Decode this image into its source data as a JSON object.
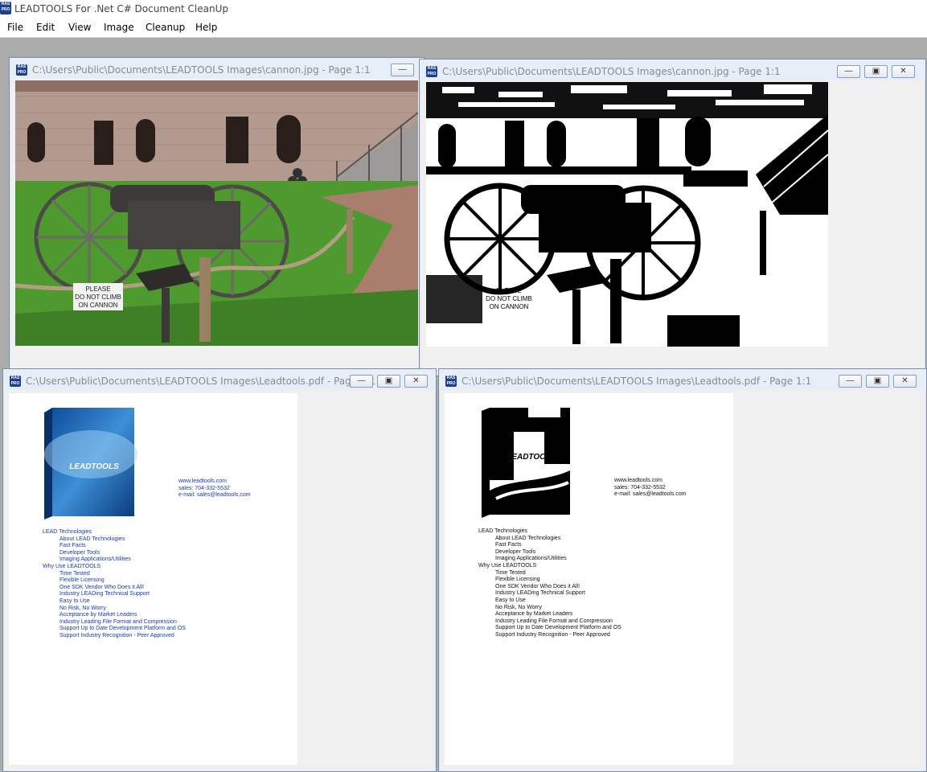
{
  "app": {
    "icon_text": "RAS PRO",
    "title": "LEADTOOLS For .Net C# Document CleanUp"
  },
  "menu": [
    "File",
    "Edit",
    "View",
    "Image",
    "Cleanup",
    "Help"
  ],
  "windows": {
    "top_left": {
      "title": "C:\\Users\\Public\\Documents\\LEADTOOLS Images\\cannon.jpg - Page 1:1"
    },
    "top_right": {
      "title": "C:\\Users\\Public\\Documents\\LEADTOOLS Images\\cannon.jpg - Page 1:1"
    },
    "bottom_left": {
      "title": "C:\\Users\\Public\\Documents\\LEADTOOLS Images\\Leadtools.pdf - Page 1:1"
    },
    "bottom_right": {
      "title": "C:\\Users\\Public\\Documents\\LEADTOOLS Images\\Leadtools.pdf - Page 1:1"
    }
  },
  "window_buttons": {
    "minimize": "—",
    "restore": "▣",
    "close": "✕"
  },
  "sign_text": [
    "PLEASE",
    "DO NOT CLIMB",
    "ON CANNON"
  ],
  "box_logo": "LEADTOOLS",
  "contact": {
    "url": "www.leadtools.com",
    "sales": "sales: 704-332-5532",
    "email": "e-mail: sales@leadtools.com"
  },
  "doc_lines": {
    "heading1": "LEAD Technologies",
    "group1": [
      "About LEAD Technologies",
      "Fast Facts",
      "Developer Tools",
      "Imaging Applications/Utilities"
    ],
    "heading2": "Why Use LEADTOOLS",
    "group2": [
      "Time Tested",
      "Flexible Licensing",
      "One SDK Vendor Who Does it All!",
      "Industry LEADing Technical Support",
      "Easy to Use",
      "No Risk, No Worry",
      "Acceptance by Market Leaders",
      "Industry Leading File Format and Compression",
      "Support Up to Date Development Platform and OS",
      "Support Industry Recognition - Peer Approved"
    ]
  }
}
